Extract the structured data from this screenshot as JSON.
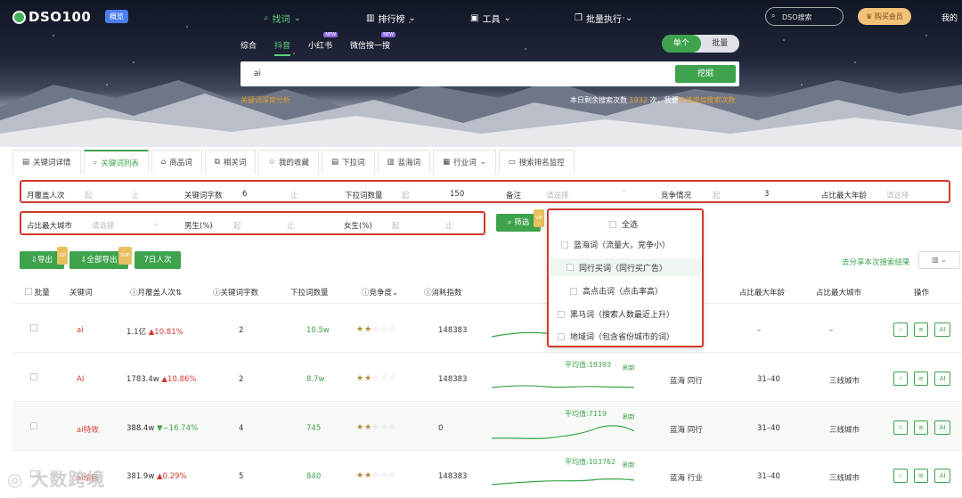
{
  "brand": {
    "name": "DSO100",
    "badge": "概览"
  },
  "nav": {
    "items": [
      "找词",
      "排行榜",
      "工具",
      "批量执行"
    ],
    "search_placeholder": "DSO搜索",
    "vip": "购买会员",
    "mine": "我的"
  },
  "platforms": {
    "items": [
      "综合",
      "抖音",
      "小红书",
      "微信搜一搜"
    ],
    "new_tag": "NEW"
  },
  "mode": {
    "single": "单个",
    "batch": "批量"
  },
  "search": {
    "value": "ai",
    "button": "挖掘"
  },
  "hints": {
    "left": "关键词深度分析",
    "right_prefix": "本日剩余搜索次数",
    "right_count": "1932",
    "right_mid": "次，我要",
    "right_link": "申请增加搜索次数"
  },
  "tabs": [
    "关键词详情",
    "关键词列表",
    "商品词",
    "相关词",
    "我的收藏",
    "下拉词",
    "蓝海词",
    "行业词",
    "搜索排名监控"
  ],
  "filters": {
    "row1": {
      "monthly_label": "月覆盖人次",
      "from": "起",
      "to": "止",
      "chars_label": "关键词字数",
      "chars_from": "6",
      "dropdown_label": "下拉词数量",
      "dropdown_to": "150",
      "remark_label": "备注",
      "remark_placeholder": "请选择",
      "comp_label": "竞争情况",
      "comp_to": "3",
      "age_label": "占比最大年龄",
      "age_placeholder": "请选择"
    },
    "row2": {
      "city_label": "占比最大城市",
      "city_placeholder": "请选择",
      "male_label": "男生(%)",
      "female_label": "女生(%)",
      "filter_btn": "筛选"
    }
  },
  "remark_dropdown": {
    "all": "全选",
    "items": [
      "蓝海词（流量大，竞争小）",
      "同行买词（同行买广告）",
      "高点击词（点击率高）",
      "黑马词（搜索人数最近上升）",
      "地域词（包含省份城市的词）"
    ]
  },
  "actions": {
    "export": "导出",
    "export_all": "全部导出",
    "days7": "7日人次",
    "share": "去分享本次搜索结果",
    "columns": "列"
  },
  "table": {
    "headers": [
      "批量",
      "关键词",
      "月覆盖人次",
      "关键词字数",
      "下拉词数量",
      "竞争度",
      "消耗指数",
      "占比最大年龄",
      "占比最大城市",
      "操作"
    ],
    "rows": [
      {
        "keyword": "ai",
        "monthly": "1.1亿",
        "change": "10.81%",
        "dir": "up",
        "chars": "2",
        "dropdown": "10.5w",
        "stars": 2,
        "index": "148383",
        "avg": "",
        "new": "",
        "tags": "",
        "age": "–",
        "city": "–"
      },
      {
        "keyword": "AI",
        "monthly": "1783.4w",
        "change": "10.86%",
        "dir": "up",
        "chars": "2",
        "dropdown": "8.7w",
        "stars": 2,
        "index": "148383",
        "avg": "平均值:18393",
        "new": "刷新",
        "tags": "蓝海 同行",
        "age": "31–40",
        "city": "三线城市"
      },
      {
        "keyword": "ai特效",
        "monthly": "388.4w",
        "change": "−16.74%",
        "dir": "down",
        "chars": "4",
        "dropdown": "745",
        "stars": 2,
        "index": "0",
        "avg": "平均值:7119",
        "new": "刷新",
        "tags": "蓝海 同行",
        "age": "31–40",
        "city": "三线城市"
      },
      {
        "keyword": "ai绘画",
        "monthly": "381.9w",
        "change": "0.29%",
        "dir": "up",
        "chars": "5",
        "dropdown": "840",
        "stars": 2,
        "index": "148383",
        "avg": "平均值:103762",
        "new": "刷新",
        "tags": "蓝海 行业",
        "age": "31–40",
        "city": "三线城市"
      }
    ],
    "op_labels": [
      "☆",
      "≡",
      "AI"
    ]
  },
  "watermark": "大数跨境"
}
